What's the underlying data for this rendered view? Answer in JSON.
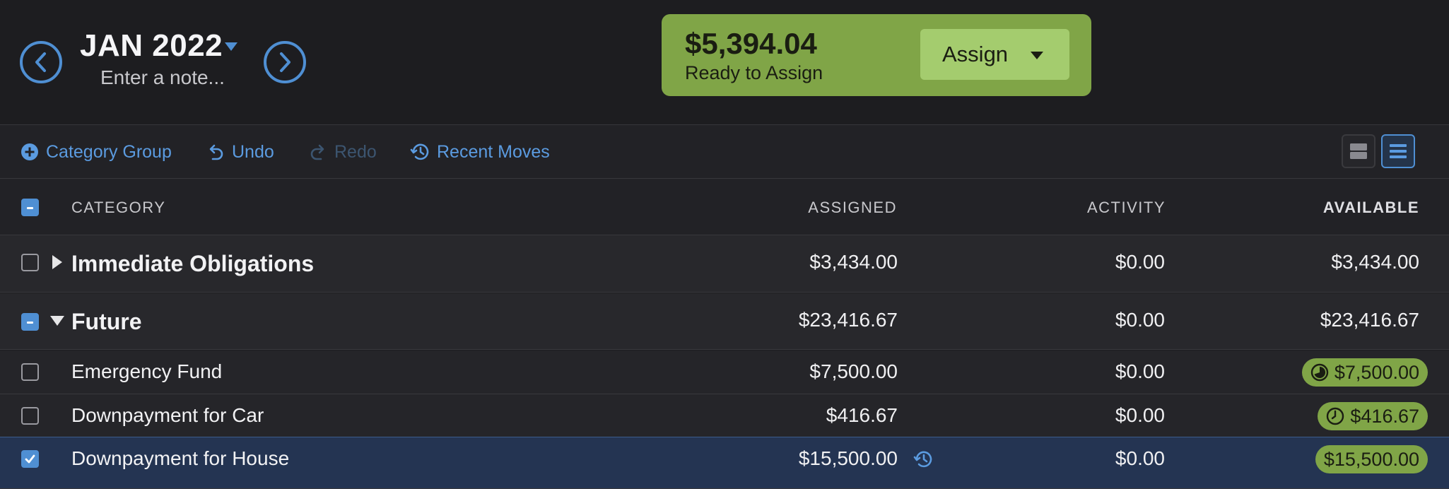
{
  "header": {
    "month": "JAN 2022",
    "note_placeholder": "Enter a note...",
    "ready_amount": "$5,394.04",
    "ready_label": "Ready to Assign",
    "assign_label": "Assign"
  },
  "toolbar": {
    "category_group": "Category Group",
    "undo": "Undo",
    "redo": "Redo",
    "recent_moves": "Recent Moves"
  },
  "table": {
    "headers": {
      "category": "CATEGORY",
      "assigned": "ASSIGNED",
      "activity": "ACTIVITY",
      "available": "AVAILABLE"
    },
    "rows": [
      {
        "name": "Immediate Obligations",
        "assigned": "$3,434.00",
        "activity": "$0.00",
        "available": "$3,434.00"
      },
      {
        "name": "Future",
        "assigned": "$23,416.67",
        "activity": "$0.00",
        "available": "$23,416.67"
      },
      {
        "name": "Emergency Fund",
        "assigned": "$7,500.00",
        "activity": "$0.00",
        "available": "$7,500.00"
      },
      {
        "name": "Downpayment for Car",
        "assigned": "$416.67",
        "activity": "$0.00",
        "available": "$416.67"
      },
      {
        "name": "Downpayment for House",
        "assigned": "$15,500.00",
        "activity": "$0.00",
        "available": "$15,500.00"
      }
    ]
  },
  "colors": {
    "accent": "#4f8fd3",
    "funded": "#80a547",
    "background": "#1d1d20",
    "selected_row": "#243452"
  },
  "icons": {
    "prev_month": "chevron-left-icon",
    "next_month": "chevron-right-icon",
    "add": "plus-circle-icon",
    "undo": "undo-icon",
    "redo": "redo-icon",
    "recent": "history-icon",
    "goal_progress": "pie-progress-icon",
    "goal_clock": "clock-icon"
  }
}
